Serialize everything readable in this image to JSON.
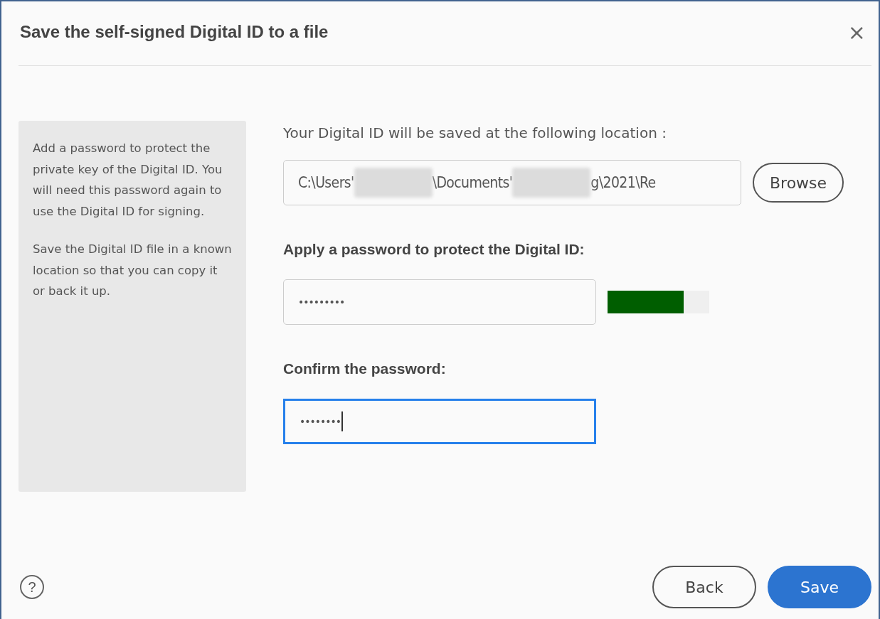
{
  "window": {
    "title": "Save the self-signed Digital ID to a file",
    "close": "×"
  },
  "info_panel": {
    "paragraphs": [
      "Add a password to protect the private key of the Digital ID. You will need this password again to use the Digital ID for signing.",
      "Save the Digital ID file in a known location so that you can copy it or back it up."
    ]
  },
  "location": {
    "label": "Your Digital ID will be saved at the following location :",
    "path_parts": [
      {
        "kind": "text",
        "text": "C:\\Users'"
      },
      {
        "kind": "redacted"
      },
      {
        "kind": "text",
        "text": "\\Documents'"
      },
      {
        "kind": "redacted"
      },
      {
        "kind": "text",
        "text": "g\\2021\\Re"
      }
    ],
    "browse_button": "Browse"
  },
  "password": {
    "label": "Apply a password to protect the Digital ID:",
    "value": "•••••••••",
    "focused": false,
    "strength": {
      "level": 0.75
    }
  },
  "confirm": {
    "label": "Confirm the password:",
    "value": "••••••••",
    "focused": true
  },
  "footer": {
    "help": "?",
    "buttons": [
      {
        "label": "Back",
        "kind": "secondary"
      },
      {
        "label": "Save",
        "kind": "primary"
      }
    ]
  }
}
